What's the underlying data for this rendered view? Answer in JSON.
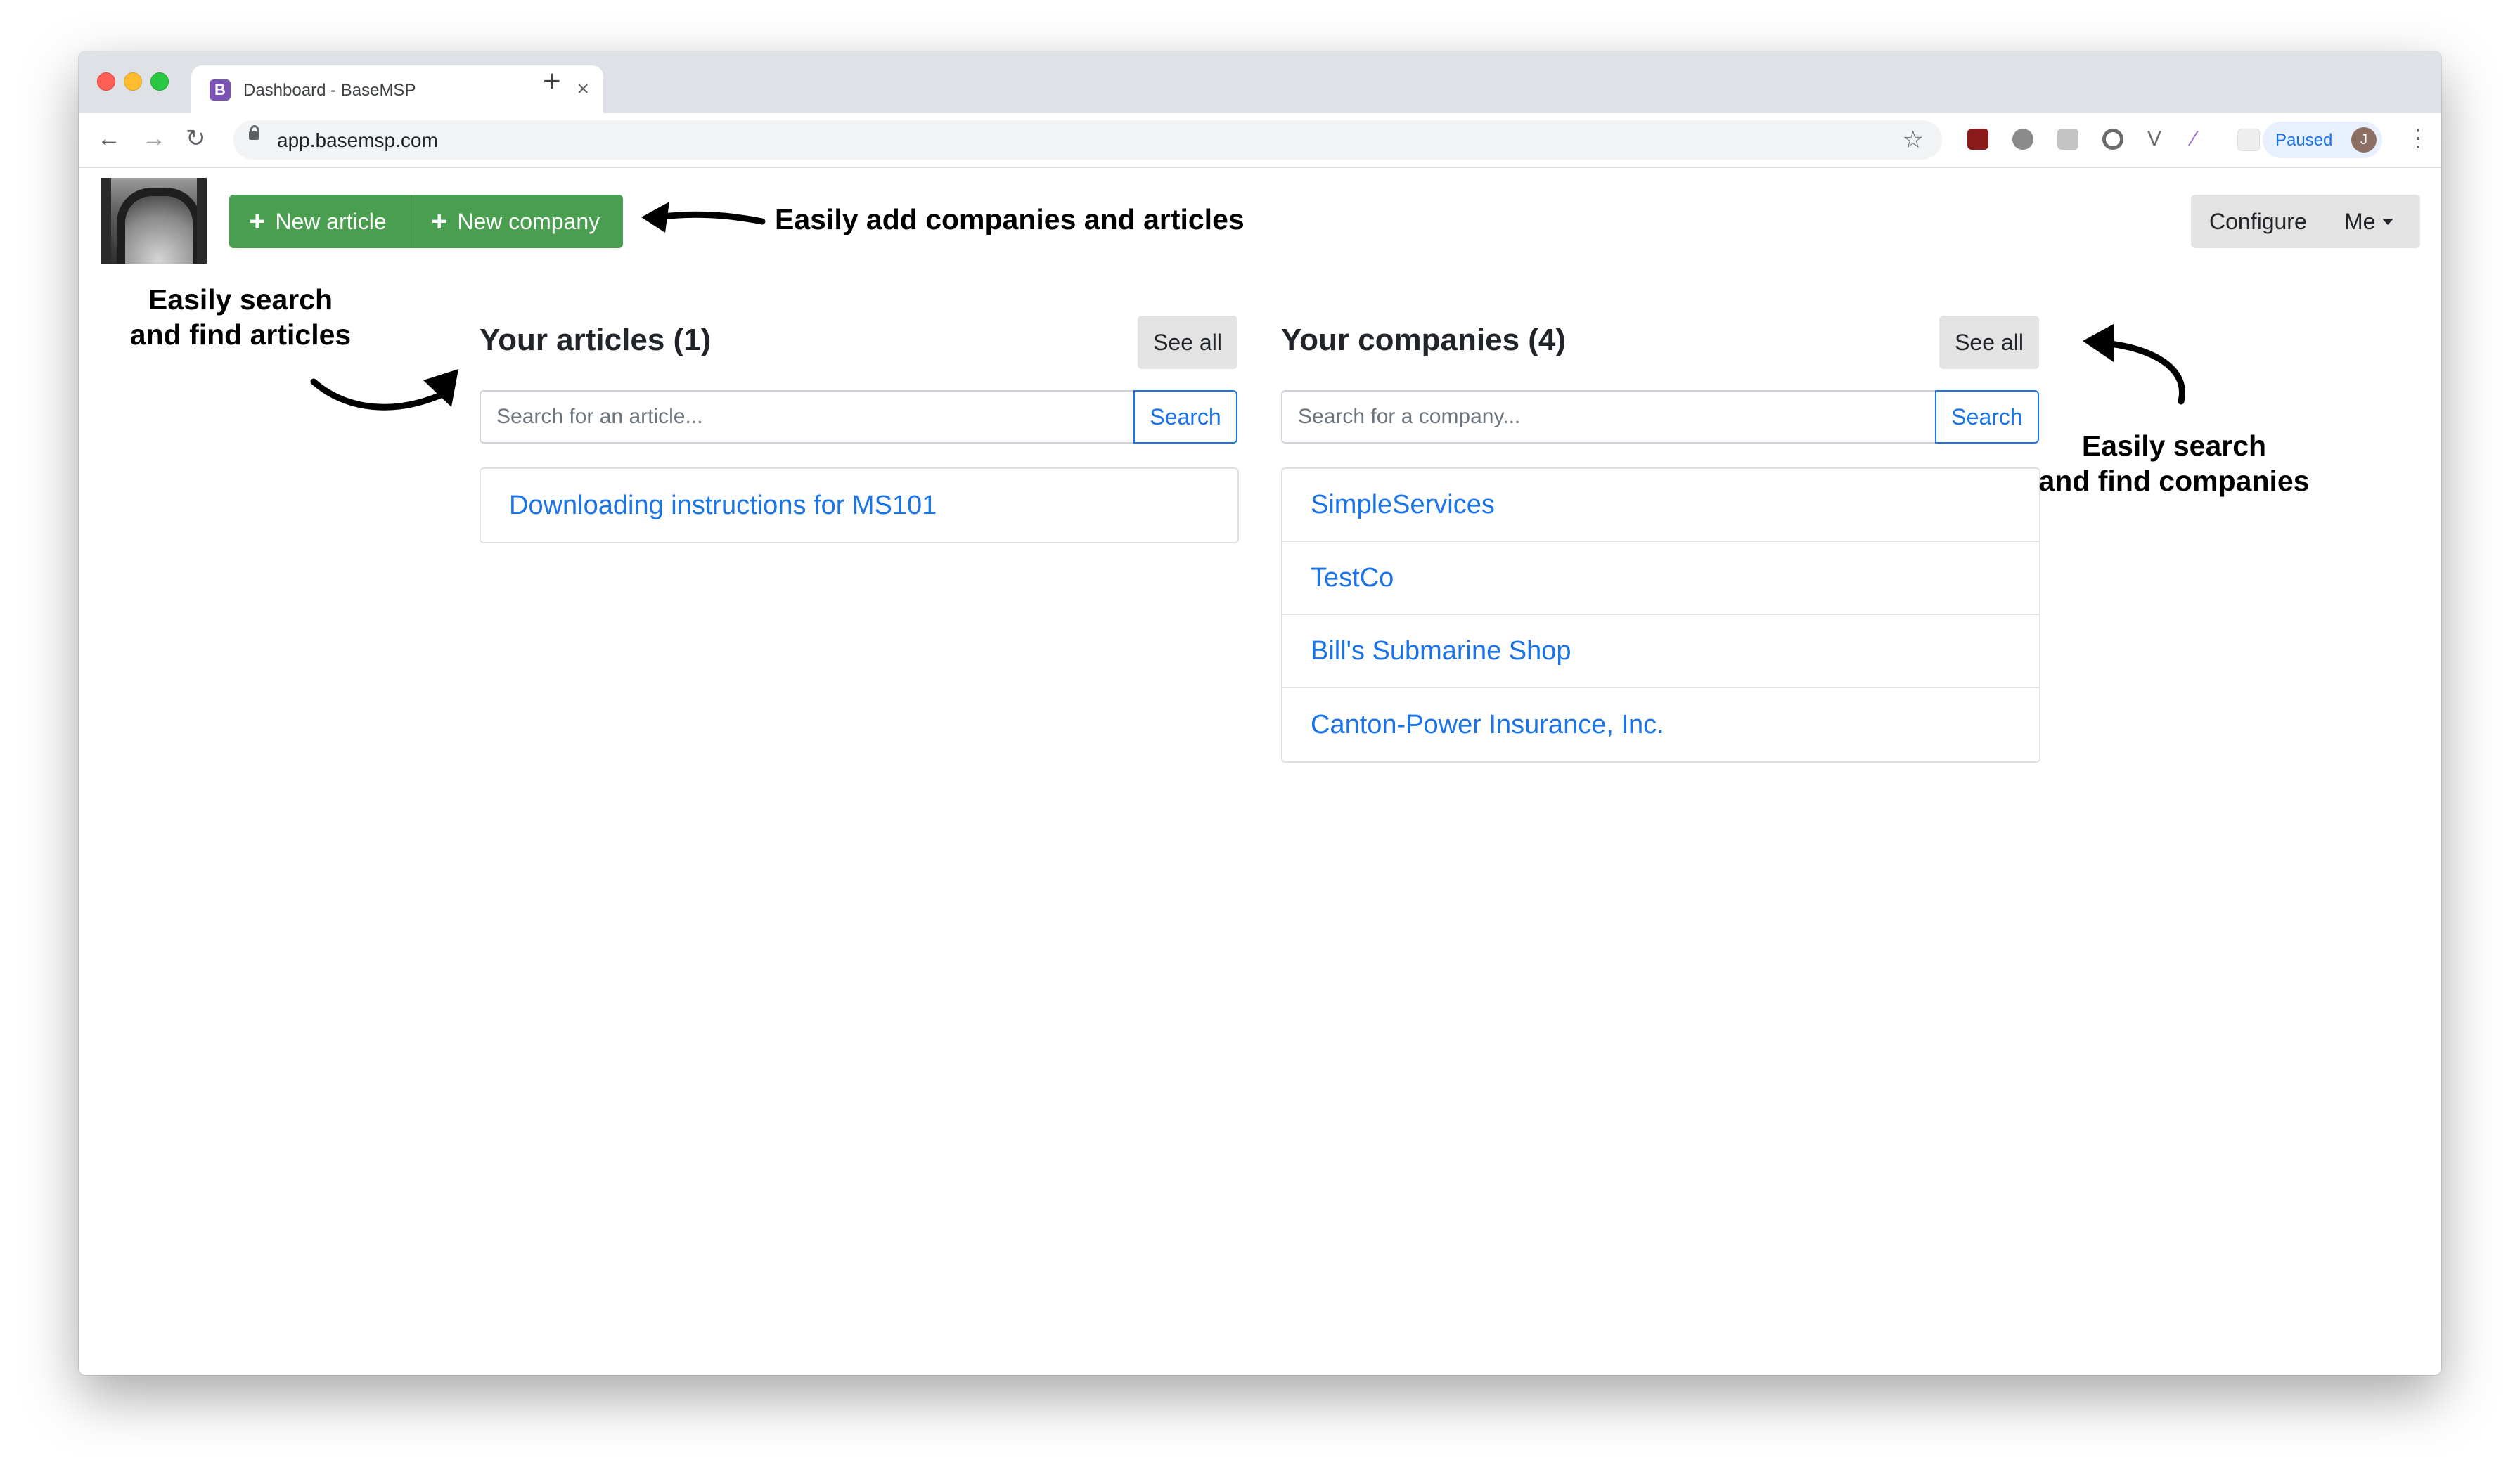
{
  "browser": {
    "tab_title": "Dashboard - BaseMSP",
    "favicon_letter": "B",
    "url": "app.basemsp.com",
    "profile_status": "Paused",
    "profile_initial": "J"
  },
  "header": {
    "new_article_label": "New article",
    "new_company_label": "New company",
    "configure_label": "Configure",
    "me_label": "Me"
  },
  "annotations": {
    "add": "Easily add companies and articles",
    "search_articles_line1": "Easily search",
    "search_articles_line2": "and find articles",
    "search_companies_line1": "Easily search",
    "search_companies_line2": "and find companies"
  },
  "articles": {
    "title": "Your articles (1)",
    "see_all_label": "See all",
    "search_placeholder": "Search for an article...",
    "search_button": "Search",
    "items": [
      "Downloading instructions for MS101"
    ]
  },
  "companies": {
    "title": "Your companies (4)",
    "see_all_label": "See all",
    "search_placeholder": "Search for a company...",
    "search_button": "Search",
    "items": [
      "SimpleServices",
      "TestCo",
      "Bill's Submarine Shop",
      "Canton-Power Insurance, Inc."
    ]
  },
  "colors": {
    "accent": "#1a73e8",
    "green_button": "#4a9e4f",
    "neutral_button": "#e3e3e3"
  }
}
